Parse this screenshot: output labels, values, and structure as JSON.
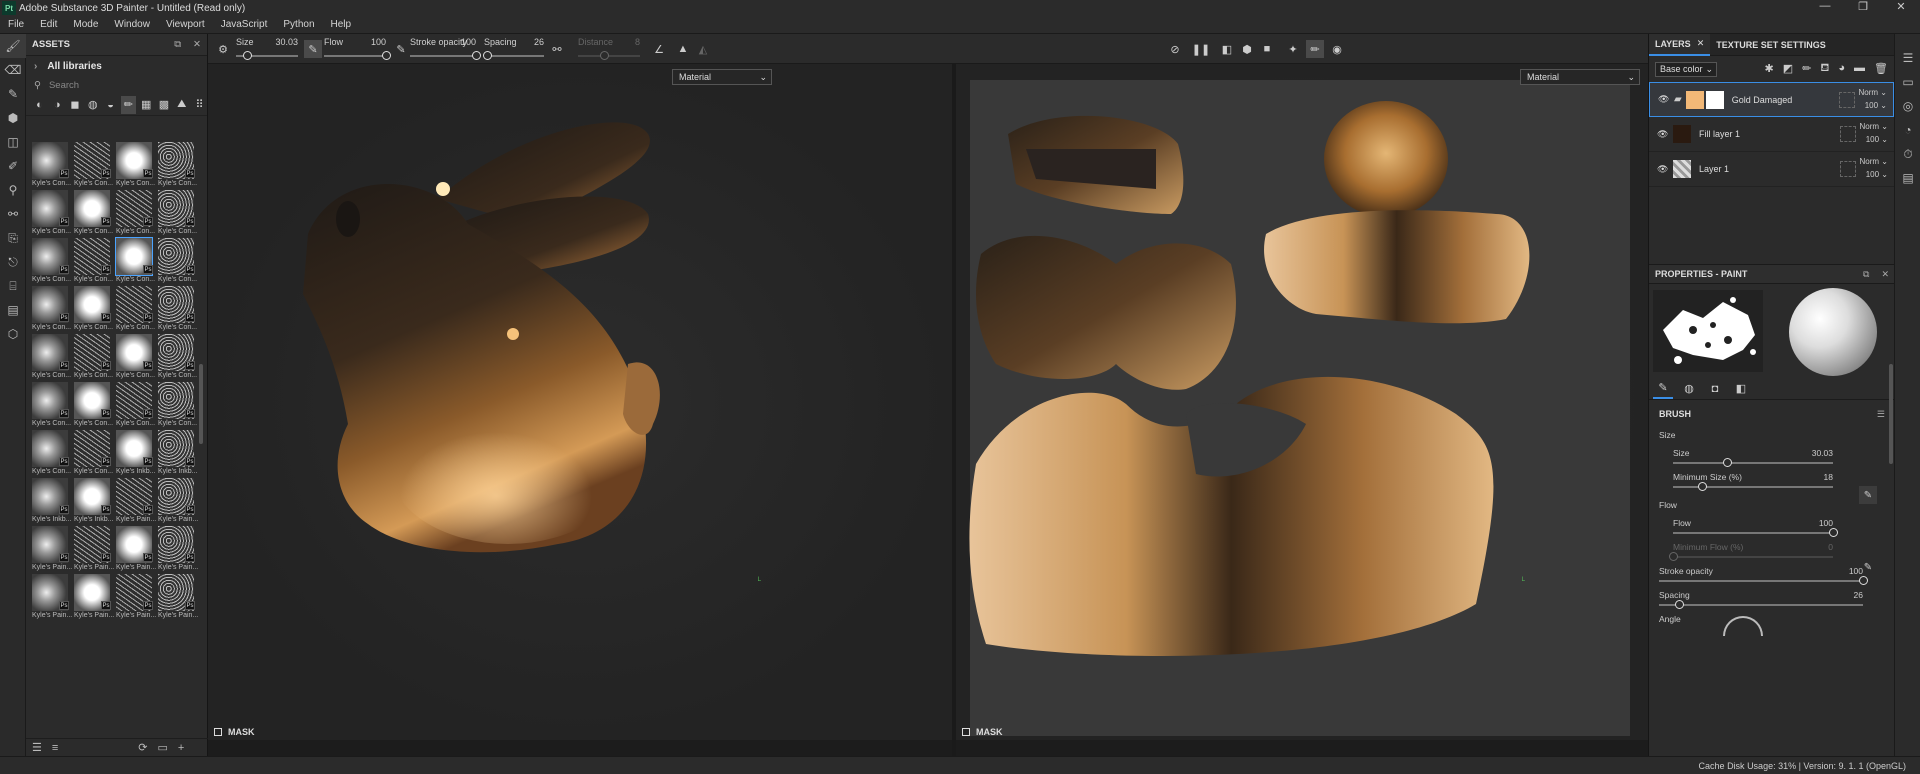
{
  "window": {
    "app_icon": "Pt",
    "title": "Adobe Substance 3D Painter - Untitled (Read only)",
    "controls": [
      "—",
      "❐",
      "✕"
    ]
  },
  "menu": [
    "File",
    "Edit",
    "Mode",
    "Window",
    "Viewport",
    "JavaScript",
    "Python",
    "Help"
  ],
  "assets": {
    "title": "ASSETS",
    "all_libraries": "All libraries",
    "search_placeholder": "Search",
    "tile_badge": "Ps",
    "tiles": [
      "Kyle's Con...",
      "Kyle's Con...",
      "Kyle's Con...",
      "Kyle's Con...",
      "Kyle's Con...",
      "Kyle's Con...",
      "Kyle's Con...",
      "Kyle's Con...",
      "Kyle's Con...",
      "Kyle's Con...",
      "Kyle's Con...",
      "Kyle's Con...",
      "Kyle's Con...",
      "Kyle's Con...",
      "Kyle's Con...",
      "Kyle's Con...",
      "Kyle's Con...",
      "Kyle's Con...",
      "Kyle's Con...",
      "Kyle's Con...",
      "Kyle's Con...",
      "Kyle's Con...",
      "Kyle's Con...",
      "Kyle's Con...",
      "Kyle's Con...",
      "Kyle's Con...",
      "Kyle's Inkb...",
      "Kyle's Inkb...",
      "Kyle's Inkb...",
      "Kyle's Inkb...",
      "Kyle's Pain...",
      "Kyle's Pain...",
      "Kyle's Pain...",
      "Kyle's Pain...",
      "Kyle's Pain...",
      "Kyle's Pain...",
      "Kyle's Pain...",
      "Kyle's Pain...",
      "Kyle's Pain...",
      "Kyle's Pain..."
    ],
    "selected_tile_index": 10
  },
  "context_bar": {
    "size_label": "Size",
    "size_value": "30.03",
    "size_fraction": 0.18,
    "flow_label": "Flow",
    "flow_value": "100",
    "flow_fraction": 1.0,
    "stroke_opacity_label": "Stroke opacity",
    "stroke_opacity_value": "100",
    "stroke_opacity_fraction": 1.0,
    "spacing_label": "Spacing",
    "spacing_value": "26",
    "spacing_fraction": 0.05,
    "distance_label": "Distance",
    "distance_value": "8"
  },
  "viewport_3d": {
    "material_dropdown": "Material",
    "mask_label": "MASK"
  },
  "viewport_2d": {
    "material_dropdown": "Material",
    "mask_label": "MASK"
  },
  "layers_panel": {
    "tab_layers": "LAYERS",
    "tab_texture_set": "TEXTURE SET SETTINGS",
    "channel_dropdown": "Base color",
    "layers": [
      {
        "name": "Gold Damaged",
        "blend": "Norm",
        "opacity": "100",
        "swatch": "#f2b877",
        "selected": true
      },
      {
        "name": "Fill layer 1",
        "blend": "Norm",
        "opacity": "100",
        "swatch": "#2a1a10",
        "selected": false
      },
      {
        "name": "Layer 1",
        "blend": "Norm",
        "opacity": "100",
        "swatch": "#cccccc",
        "selected": false
      }
    ]
  },
  "properties": {
    "title": "PROPERTIES - PAINT",
    "brush_section": "BRUSH",
    "size_group": "Size",
    "size_label": "Size",
    "size_value": "30.03",
    "size_fraction": 0.34,
    "min_size_label": "Minimum Size (%)",
    "min_size_value": "18",
    "min_size_fraction": 0.18,
    "flow_group": "Flow",
    "flow_label": "Flow",
    "flow_value": "100",
    "flow_fraction": 1.0,
    "min_flow_label": "Minimum Flow (%)",
    "min_flow_value": "0",
    "min_flow_fraction": 0.0,
    "stroke_opacity_label": "Stroke opacity",
    "stroke_opacity_value": "100",
    "stroke_opacity_fraction": 1.0,
    "spacing_label": "Spacing",
    "spacing_value": "26",
    "spacing_fraction": 0.1,
    "angle_label": "Angle"
  },
  "status": {
    "text": "Cache Disk Usage:   31% | Version: 9. 1. 1 (OpenGL)"
  },
  "colors": {
    "accent": "#3a8ee6",
    "gold": "#c98f4a",
    "panel": "#2b2b2b"
  }
}
